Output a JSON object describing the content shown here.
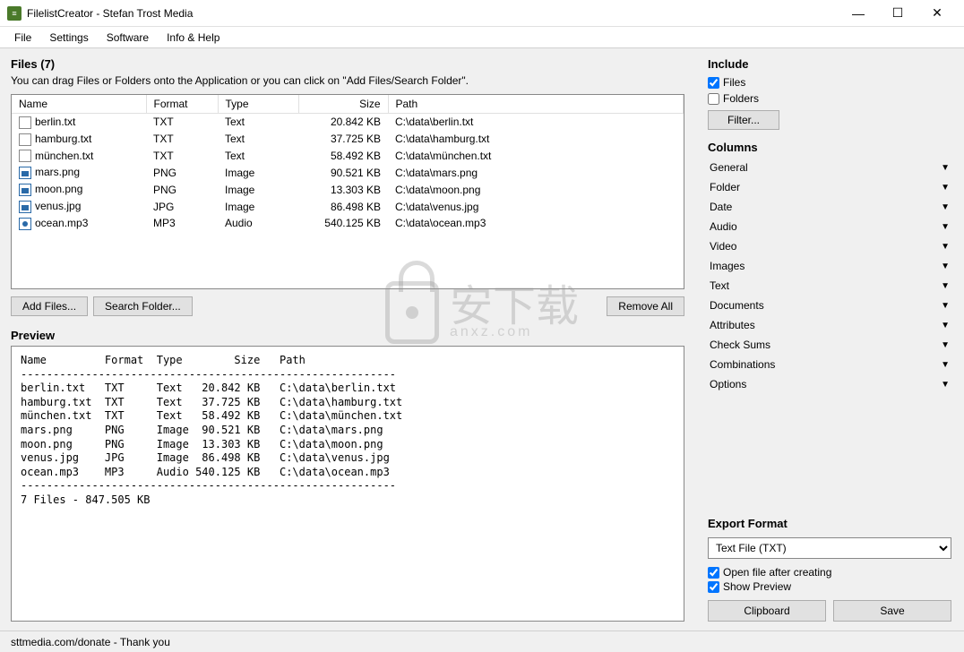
{
  "title": "FilelistCreator - Stefan Trost Media",
  "menu": [
    "File",
    "Settings",
    "Software",
    "Info & Help"
  ],
  "files_heading": "Files (7)",
  "hint": "You can drag Files or Folders onto the Application or you can click on \"Add Files/Search Folder\".",
  "columns_header": [
    "Name",
    "Format",
    "Type",
    "Size",
    "Path"
  ],
  "files": [
    {
      "name": "berlin.txt",
      "format": "TXT",
      "type": "Text",
      "size": "20.842 KB",
      "path": "C:\\data\\berlin.txt",
      "icon": "txt"
    },
    {
      "name": "hamburg.txt",
      "format": "TXT",
      "type": "Text",
      "size": "37.725 KB",
      "path": "C:\\data\\hamburg.txt",
      "icon": "txt"
    },
    {
      "name": "münchen.txt",
      "format": "TXT",
      "type": "Text",
      "size": "58.492 KB",
      "path": "C:\\data\\münchen.txt",
      "icon": "txt"
    },
    {
      "name": "mars.png",
      "format": "PNG",
      "type": "Image",
      "size": "90.521 KB",
      "path": "C:\\data\\mars.png",
      "icon": "img"
    },
    {
      "name": "moon.png",
      "format": "PNG",
      "type": "Image",
      "size": "13.303 KB",
      "path": "C:\\data\\moon.png",
      "icon": "img"
    },
    {
      "name": "venus.jpg",
      "format": "JPG",
      "type": "Image",
      "size": "86.498 KB",
      "path": "C:\\data\\venus.jpg",
      "icon": "img"
    },
    {
      "name": "ocean.mp3",
      "format": "MP3",
      "type": "Audio",
      "size": "540.125 KB",
      "path": "C:\\data\\ocean.mp3",
      "icon": "aud"
    }
  ],
  "buttons": {
    "add_files": "Add Files...",
    "search_folder": "Search Folder...",
    "remove_all": "Remove All",
    "filter": "Filter...",
    "clipboard": "Clipboard",
    "save": "Save"
  },
  "preview_heading": "Preview",
  "preview_text": "Name         Format  Type        Size   Path                 \n----------------------------------------------------------\nberlin.txt   TXT     Text   20.842 KB   C:\\data\\berlin.txt\nhamburg.txt  TXT     Text   37.725 KB   C:\\data\\hamburg.txt\nmünchen.txt  TXT     Text   58.492 KB   C:\\data\\münchen.txt\nmars.png     PNG     Image  90.521 KB   C:\\data\\mars.png\nmoon.png     PNG     Image  13.303 KB   C:\\data\\moon.png\nvenus.jpg    JPG     Image  86.498 KB   C:\\data\\venus.jpg\nocean.mp3    MP3     Audio 540.125 KB   C:\\data\\ocean.mp3\n----------------------------------------------------------\n7 Files - 847.505 KB",
  "include": {
    "heading": "Include",
    "files": "Files",
    "folders": "Folders",
    "files_checked": true,
    "folders_checked": false
  },
  "columns_section": {
    "heading": "Columns",
    "items": [
      "General",
      "Folder",
      "Date",
      "Audio",
      "Video",
      "Images",
      "Text",
      "Documents",
      "Attributes",
      "Check Sums",
      "Combinations",
      "Options"
    ]
  },
  "export": {
    "heading": "Export Format",
    "selected": "Text File (TXT)",
    "open_after": "Open file after creating",
    "show_preview": "Show Preview",
    "open_checked": true,
    "preview_checked": true
  },
  "status": "sttmedia.com/donate - Thank you",
  "watermark": {
    "main": "安下载",
    "sub": "anxz.com"
  }
}
